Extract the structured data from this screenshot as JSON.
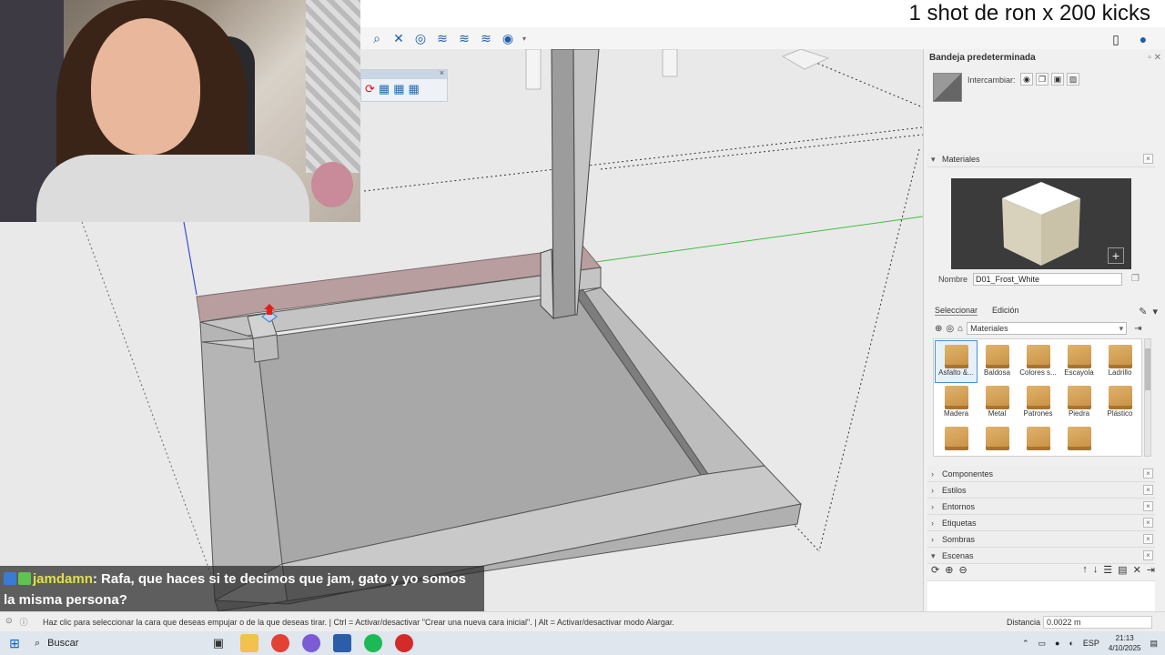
{
  "overlay_title": "1 shot de ron x 200 kicks",
  "toolbar": {
    "icons": [
      "zoom-icon",
      "zoom-extents-icon",
      "orbit-icon",
      "section-plane-icon",
      "section-display-icon",
      "section-cut-icon",
      "geo-icon"
    ],
    "right_icons": [
      "document-icon",
      "user-icon"
    ]
  },
  "tray": {
    "title": "Bandeja predeterminada",
    "swap_label": "Intercambiar:",
    "materials_header": "Materiales",
    "name_label": "Nombre",
    "name_value": "D01_Frost_White",
    "tabs": [
      "Seleccionar",
      "Edición"
    ],
    "library": "Materiales",
    "materials": [
      {
        "label": "Asfalto &...",
        "selected": true
      },
      {
        "label": "Baldosa"
      },
      {
        "label": "Colores s..."
      },
      {
        "label": "Escayola"
      },
      {
        "label": "Ladrillo"
      },
      {
        "label": "Madera"
      },
      {
        "label": "Metal"
      },
      {
        "label": "Patrones"
      },
      {
        "label": "Piedra"
      },
      {
        "label": "Plástico"
      },
      {
        "label": ""
      },
      {
        "label": ""
      },
      {
        "label": ""
      },
      {
        "label": ""
      }
    ],
    "sections": [
      "Componentes",
      "Estilos",
      "Entornos",
      "Etiquetas",
      "Sombras",
      "Escenas"
    ]
  },
  "chat": {
    "user": "jamdamn",
    "message": ": Rafa, que haces si te decimos que jam, gato y yo somos la misma persona?",
    "badge_colors": [
      "#3a7bd5",
      "#5ec44f"
    ]
  },
  "status": {
    "message": "Haz clic para seleccionar la cara que deseas empujar o de la que deseas tirar. | Ctrl = Activar/desactivar \"Crear una nueva cara inicial\". | Alt = Activar/desactivar modo Alargar.",
    "distance_label": "Distancia",
    "distance_value": "0.0022 m"
  },
  "taskbar": {
    "search_label": "Buscar",
    "apps": [
      "widgets-icon",
      "task-view-icon",
      "file-explorer-icon",
      "chrome-icon",
      "discord-icon",
      "sketchup-icon",
      "spotify-icon",
      "app-icon"
    ],
    "language": "ESP",
    "time": "21:13",
    "date": "4/10/2025"
  },
  "colors": {
    "viewport_bg": "#e9e9e9",
    "axis_green": "#3fbf3f",
    "axis_blue": "#3a4fd0",
    "selection_face": "#b99ea0"
  }
}
